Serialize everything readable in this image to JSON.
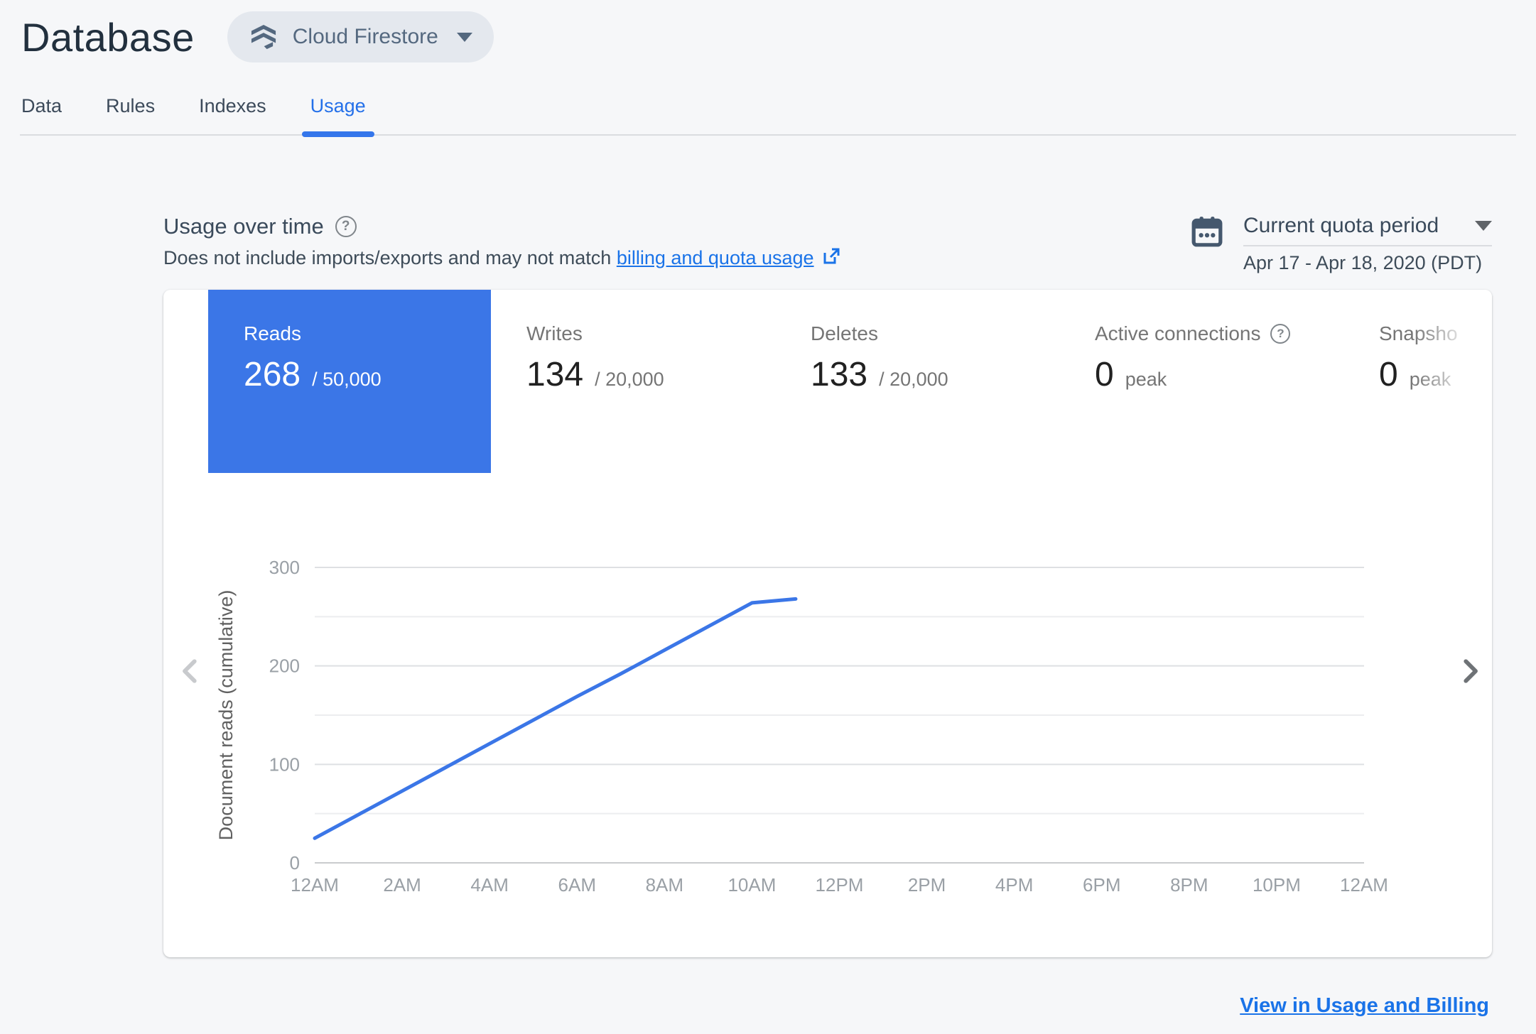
{
  "colors": {
    "accent_blue": "#1A73E8",
    "tab_active_blue": "#2470E9",
    "selected_card_blue": "#3B76E7",
    "chart_line_blue": "#3B76E7",
    "page_background": "#F6F7F9",
    "title_color": "#22303E"
  },
  "icons": {
    "help": "?"
  },
  "header": {
    "title": "Database",
    "product_selector": {
      "label": "Cloud Firestore"
    }
  },
  "tabs": [
    {
      "label": "Data"
    },
    {
      "label": "Rules"
    },
    {
      "label": "Indexes"
    },
    {
      "label": "Usage"
    }
  ],
  "usage_section": {
    "title": "Usage over time",
    "subtitle_prefix": "Does not include imports/exports and may not match ",
    "subtitle_link": "billing and quota usage",
    "quota_period": {
      "label": "Current quota period",
      "range": "Apr 17 - Apr 18, 2020 (PDT)"
    }
  },
  "metric_cards": [
    {
      "label": "Reads",
      "value": "268",
      "suffix": "/ 50,000",
      "selected": true
    },
    {
      "label": "Writes",
      "value": "134",
      "suffix": "/ 20,000",
      "selected": false
    },
    {
      "label": "Deletes",
      "value": "133",
      "suffix": "/ 20,000",
      "selected": false
    },
    {
      "label": "Active connections",
      "value": "0",
      "suffix": "peak",
      "selected": false
    },
    {
      "label": "Snapsho",
      "value": "0",
      "suffix": "peak",
      "selected": false
    }
  ],
  "footer": {
    "link_label": "View in Usage and Billing"
  },
  "chart_data": {
    "type": "line",
    "title": "",
    "xlabel": "",
    "ylabel": "Document reads (cumulative)",
    "ylim": [
      0,
      300
    ],
    "xlim_hours": [
      0,
      24
    ],
    "grid": true,
    "y_ticks": [
      0,
      100,
      200,
      300
    ],
    "y_minor": [
      50,
      150,
      250
    ],
    "x_ticks": [
      {
        "h": 0,
        "label": "12AM"
      },
      {
        "h": 2,
        "label": "2AM"
      },
      {
        "h": 4,
        "label": "4AM"
      },
      {
        "h": 6,
        "label": "6AM"
      },
      {
        "h": 8,
        "label": "8AM"
      },
      {
        "h": 10,
        "label": "10AM"
      },
      {
        "h": 12,
        "label": "12PM"
      },
      {
        "h": 14,
        "label": "2PM"
      },
      {
        "h": 16,
        "label": "4PM"
      },
      {
        "h": 18,
        "label": "6PM"
      },
      {
        "h": 20,
        "label": "8PM"
      },
      {
        "h": 22,
        "label": "10PM"
      },
      {
        "h": 24,
        "label": "12AM"
      }
    ],
    "series": [
      {
        "name": "Document reads (cumulative)",
        "color": "#3B76E7",
        "points": [
          [
            0,
            25
          ],
          [
            1,
            49
          ],
          [
            2,
            73
          ],
          [
            3,
            97
          ],
          [
            4,
            121
          ],
          [
            5,
            145
          ],
          [
            6,
            169
          ],
          [
            7,
            192
          ],
          [
            8,
            216
          ],
          [
            9,
            240
          ],
          [
            10,
            264
          ],
          [
            11,
            268
          ]
        ]
      }
    ],
    "legend": "none"
  }
}
